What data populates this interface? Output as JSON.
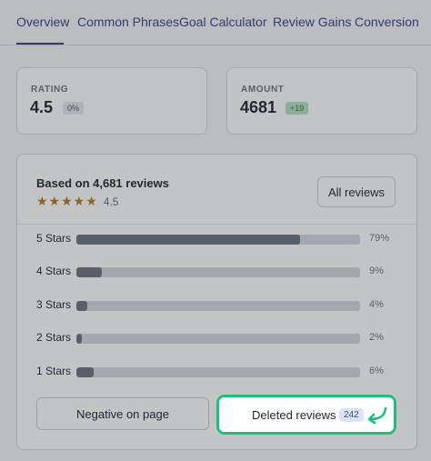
{
  "tabs": [
    {
      "label": "Overview",
      "active": true
    },
    {
      "label": "Common Phrases"
    },
    {
      "label": "Goal Calculator"
    },
    {
      "label": "Review Gains"
    },
    {
      "label": "Conversion"
    }
  ],
  "stats": {
    "rating": {
      "label": "RATING",
      "value": "4.5",
      "badge": "0%"
    },
    "amount": {
      "label": "AMOUNT",
      "value": "4681",
      "badge": "+19"
    }
  },
  "reviews": {
    "title": "Based on 4,681 reviews",
    "stars_icon": "star-icons",
    "stars_glyphs": "★★★★★",
    "score": "4.5",
    "all_reviews_label": "All reviews",
    "breakdown": [
      {
        "label": "5 Stars",
        "percent_text": "79%",
        "fill": 79
      },
      {
        "label": "4 Stars",
        "percent_text": "9%",
        "fill": 9
      },
      {
        "label": "3 Stars",
        "percent_text": "4%",
        "fill": 4
      },
      {
        "label": "2 Stars",
        "percent_text": "2%",
        "fill": 2
      },
      {
        "label": "1 Stars",
        "percent_text": "6%",
        "fill": 6
      }
    ],
    "negative_label": "Negative on page",
    "deleted_label": "Deleted reviews",
    "deleted_count": "242"
  },
  "colors": {
    "accent": "#3a3f8c",
    "highlight": "#1fbf7a",
    "star": "#b7791f",
    "bar_fill": "#6b7280",
    "bar_track": "#d3d7de"
  }
}
